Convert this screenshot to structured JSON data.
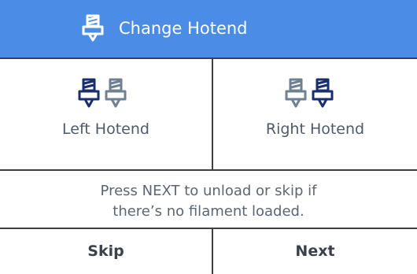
{
  "header": {
    "title": "Change Hotend",
    "icon": "hotend-icon"
  },
  "hotends": [
    {
      "label": "Left Hotend",
      "active": "left"
    },
    {
      "label": "Right Hotend",
      "active": "right"
    }
  ],
  "message": {
    "line1": "Press NEXT to unload or skip if",
    "line2": "there’s no filament loaded."
  },
  "buttons": {
    "skip": "Skip",
    "next": "Next"
  },
  "colors": {
    "header_bg": "#4a8ce6",
    "icon_active": "#1a2e6e",
    "icon_inactive": "#6f8090",
    "divider": "#3f3f3f"
  }
}
